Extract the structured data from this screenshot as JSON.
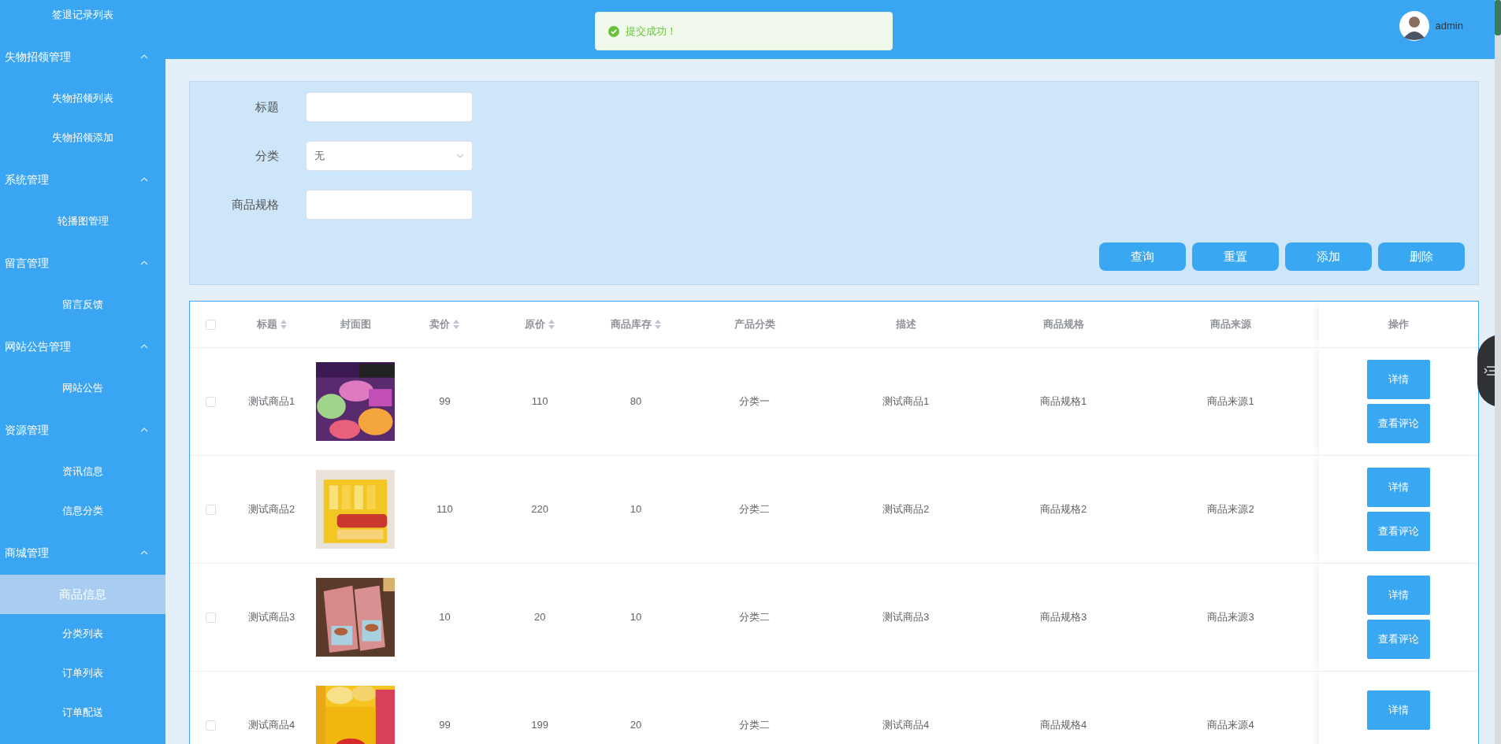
{
  "sidebar": {
    "items": [
      {
        "children": [
          {
            "label": "签退记录列表",
            "selected": false
          }
        ]
      },
      {
        "label": "失物招领管理",
        "expanded": true,
        "children": [
          {
            "label": "失物招领列表",
            "selected": false
          },
          {
            "label": "失物招领添加",
            "selected": false
          }
        ]
      },
      {
        "label": "系统管理",
        "expanded": true,
        "children": [
          {
            "label": "轮播图管理",
            "selected": false
          }
        ]
      },
      {
        "label": "留言管理",
        "expanded": true,
        "children": [
          {
            "label": "留言反馈",
            "selected": false
          }
        ]
      },
      {
        "label": "网站公告管理",
        "expanded": true,
        "children": [
          {
            "label": "网站公告",
            "selected": false
          }
        ]
      },
      {
        "label": "资源管理",
        "expanded": true,
        "children": [
          {
            "label": "资讯信息",
            "selected": false
          },
          {
            "label": "信息分类",
            "selected": false
          }
        ]
      },
      {
        "label": "商城管理",
        "expanded": true,
        "children": [
          {
            "label": "商品信息",
            "selected": true
          },
          {
            "label": "分类列表",
            "selected": false
          },
          {
            "label": "订单列表",
            "selected": false
          },
          {
            "label": "订单配送",
            "selected": false
          }
        ]
      }
    ]
  },
  "toast": {
    "kind": "success",
    "message": "提交成功！"
  },
  "user": {
    "name": "admin"
  },
  "search_form": {
    "fields": [
      {
        "label": "标题",
        "kind": "text"
      },
      {
        "label": "分类",
        "kind": "select",
        "value": "无"
      },
      {
        "label": "商品规格",
        "kind": "text"
      }
    ],
    "buttons": [
      "查询",
      "重置",
      "添加",
      "删除"
    ]
  },
  "table": {
    "header_checked": false,
    "columns": [
      {
        "label": "标题",
        "sortable": true
      },
      {
        "label": "封面图",
        "sortable": false
      },
      {
        "label": "卖价",
        "sortable": true
      },
      {
        "label": "原价",
        "sortable": true
      },
      {
        "label": "商品库存",
        "sortable": true
      },
      {
        "label": "产品分类",
        "sortable": false
      },
      {
        "label": "描述",
        "sortable": false
      },
      {
        "label": "商品规格",
        "sortable": false
      },
      {
        "label": "商品来源",
        "sortable": false
      },
      {
        "label": "操作",
        "sortable": false
      }
    ],
    "rows": [
      {
        "checked": false,
        "cells": [
          "测试商品1",
          {
            "kind": "picture"
          },
          "99",
          "110",
          "80",
          "分类一",
          "测试商品1",
          "商品规格1",
          "商品来源1"
        ],
        "actions": [
          "详情",
          "查看评论"
        ]
      },
      {
        "checked": false,
        "cells": [
          "测试商品2",
          {
            "kind": "picture"
          },
          "110",
          "220",
          "10",
          "分类二",
          "测试商品2",
          "商品规格2",
          "商品来源2"
        ],
        "actions": [
          "详情",
          "查看评论"
        ]
      },
      {
        "checked": false,
        "cells": [
          "测试商品3",
          {
            "kind": "picture"
          },
          "10",
          "20",
          "10",
          "分类二",
          "测试商品3",
          "商品规格3",
          "商品来源3"
        ],
        "actions": [
          "详情",
          "查看评论"
        ]
      },
      {
        "checked": false,
        "cells": [
          "测试商品4",
          {
            "kind": "picture"
          },
          "99",
          "199",
          "20",
          "分类二",
          "测试商品4",
          "商品规格4",
          "商品来源4"
        ],
        "actions": [
          "详情"
        ]
      }
    ]
  }
}
